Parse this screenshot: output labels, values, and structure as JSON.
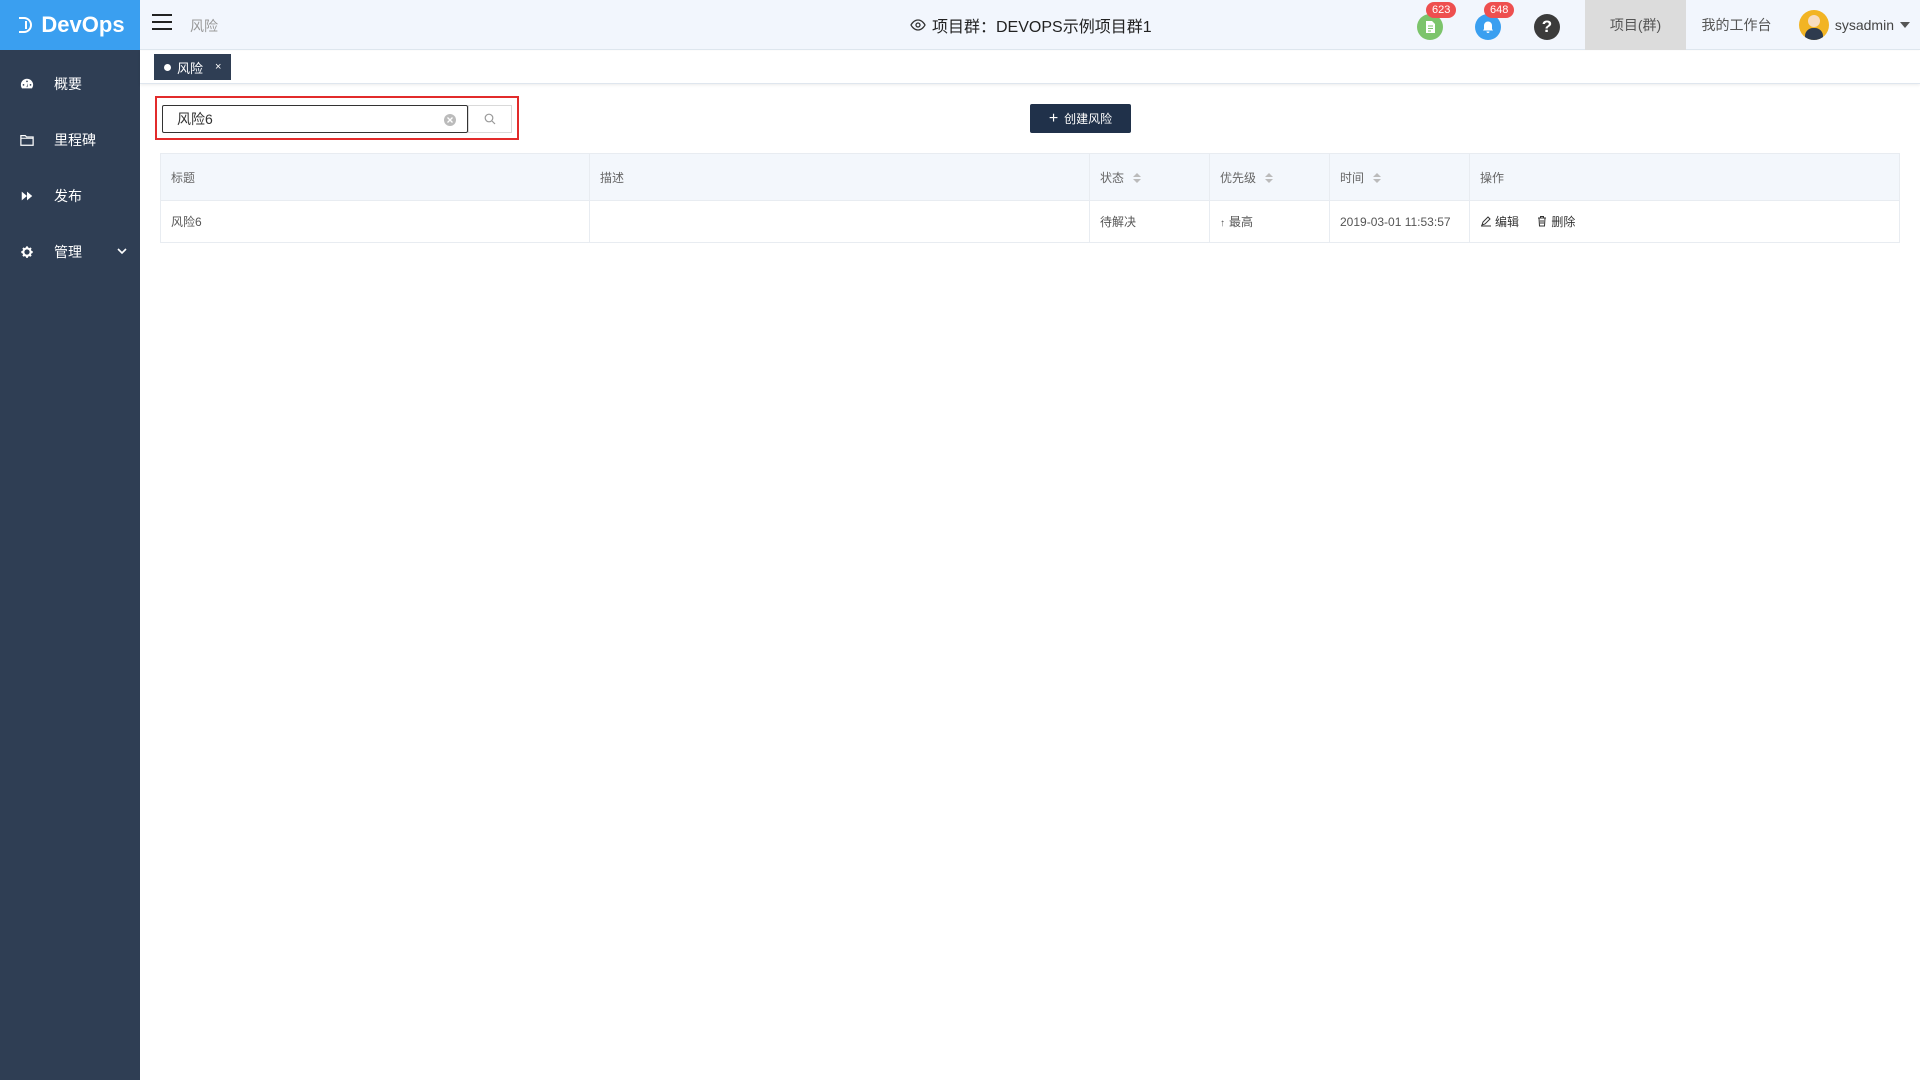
{
  "app": {
    "logo_text": "DevOps"
  },
  "sidebar": {
    "items": [
      {
        "label": "概要",
        "icon": "dashboard-icon"
      },
      {
        "label": "里程碑",
        "icon": "folder-icon"
      },
      {
        "label": "发布",
        "icon": "forward-icon"
      },
      {
        "label": "管理",
        "icon": "gear-icon"
      }
    ]
  },
  "header": {
    "breadcrumb": "风险",
    "project_title": "项目群：DEVOPS示例项目群1",
    "badge_docs": "623",
    "badge_notifications": "648",
    "tab_project": "项目(群)",
    "tab_workbench": "我的工作台",
    "username": "sysadmin"
  },
  "tabs": {
    "active_tab": "风险",
    "close": "×"
  },
  "search": {
    "value": "风险6"
  },
  "toolbar": {
    "create_label": "创建风险"
  },
  "table": {
    "headers": {
      "title": "标题",
      "description": "描述",
      "status": "状态",
      "priority": "优先级",
      "time": "时间",
      "actions": "操作"
    },
    "rows": [
      {
        "title": "风险6",
        "description": "",
        "status": "待解决",
        "priority": "最高",
        "time": "2019-03-01 11:53:57",
        "edit": "编辑",
        "delete": "删除"
      }
    ]
  },
  "colors": {
    "sidebar_bg": "#2f3e54",
    "logo_bg": "#3a9ff0",
    "highlight_border": "#e22b2b",
    "status_red": "#e24a4a"
  }
}
